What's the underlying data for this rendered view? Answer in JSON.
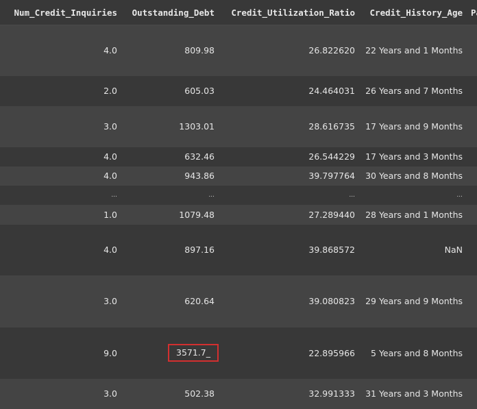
{
  "columns": [
    "Num_Credit_Inquiries",
    "Outstanding_Debt",
    "Credit_Utilization_Ratio",
    "Credit_History_Age",
    "Pa"
  ],
  "rows": [
    {
      "inquiries": "4.0",
      "debt": "809.98",
      "ratio": "26.822620",
      "history": "22 Years and 1 Months"
    },
    {
      "inquiries": "2.0",
      "debt": "605.03",
      "ratio": "24.464031",
      "history": "26 Years and 7 Months"
    },
    {
      "inquiries": "3.0",
      "debt": "1303.01",
      "ratio": "28.616735",
      "history": "17 Years and 9 Months"
    },
    {
      "inquiries": "4.0",
      "debt": "632.46",
      "ratio": "26.544229",
      "history": "17 Years and 3 Months"
    },
    {
      "inquiries": "4.0",
      "debt": "943.86",
      "ratio": "39.797764",
      "history": "30 Years and 8 Months"
    },
    {
      "inquiries": "...",
      "debt": "...",
      "ratio": "...",
      "history": "..."
    },
    {
      "inquiries": "1.0",
      "debt": "1079.48",
      "ratio": "27.289440",
      "history": "28 Years and 1 Months"
    },
    {
      "inquiries": "4.0",
      "debt": "897.16",
      "ratio": "39.868572",
      "history": "NaN"
    },
    {
      "inquiries": "3.0",
      "debt": "620.64",
      "ratio": "39.080823",
      "history": "29 Years and 9 Months"
    },
    {
      "inquiries": "9.0",
      "debt": "3571.7_",
      "ratio": "22.895966",
      "history": "5 Years and 8 Months"
    },
    {
      "inquiries": "3.0",
      "debt": "502.38",
      "ratio": "32.991333",
      "history": "31 Years and 3 Months"
    }
  ],
  "colors": {
    "background": "#383838",
    "row_alt": "#444444",
    "highlight_border": "#d32f2f"
  }
}
